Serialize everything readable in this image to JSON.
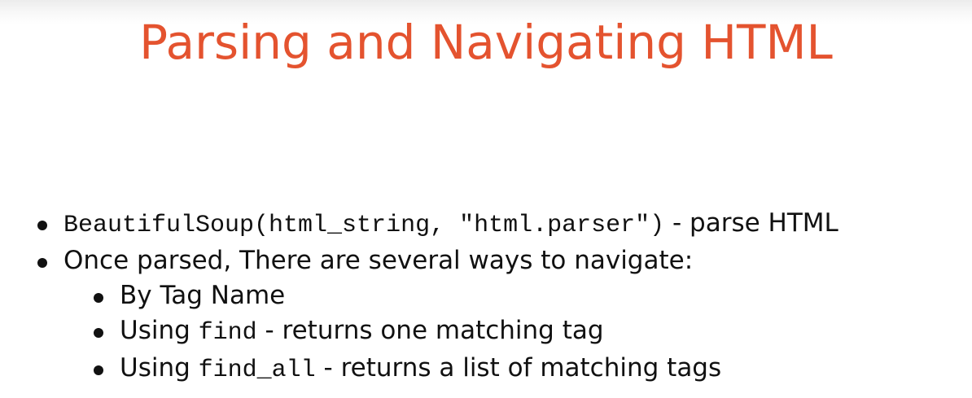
{
  "slide": {
    "title": "Parsing and Navigating HTML",
    "title_color": "#e4532f",
    "bullets": [
      {
        "level": 1,
        "code": "BeautifulSoup(html_string, \"html.parser\")",
        "text": " - parse HTML"
      },
      {
        "level": 1,
        "text": "Once parsed, There are several ways to navigate:"
      },
      {
        "level": 2,
        "text": "By Tag Name"
      },
      {
        "level": 2,
        "prefix": "Using ",
        "code": "find",
        "text": " - returns one matching tag"
      },
      {
        "level": 2,
        "prefix": "Using ",
        "code": "find_all",
        "text": " - returns a list of matching tags"
      }
    ]
  }
}
